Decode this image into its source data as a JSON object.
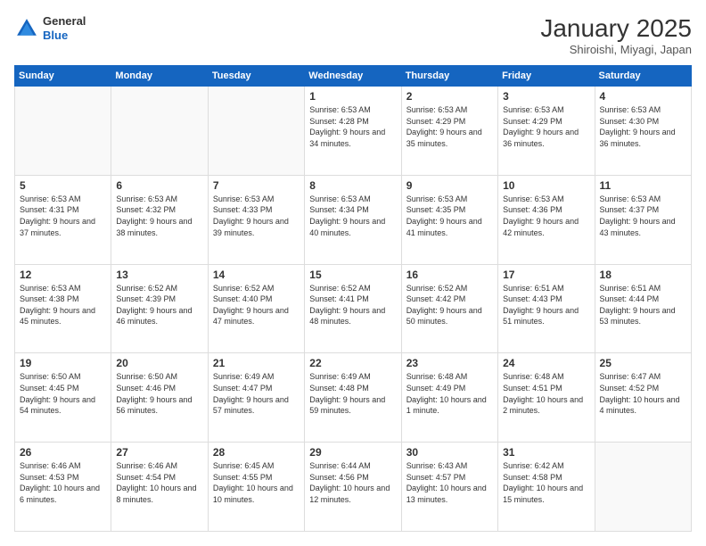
{
  "header": {
    "logo_line1": "General",
    "logo_line2": "Blue",
    "month_title": "January 2025",
    "subtitle": "Shiroishi, Miyagi, Japan"
  },
  "days_of_week": [
    "Sunday",
    "Monday",
    "Tuesday",
    "Wednesday",
    "Thursday",
    "Friday",
    "Saturday"
  ],
  "weeks": [
    [
      {
        "num": "",
        "empty": true
      },
      {
        "num": "",
        "empty": true
      },
      {
        "num": "",
        "empty": true
      },
      {
        "num": "1",
        "sunrise": "6:53 AM",
        "sunset": "4:28 PM",
        "daylight": "9 hours and 34 minutes."
      },
      {
        "num": "2",
        "sunrise": "6:53 AM",
        "sunset": "4:29 PM",
        "daylight": "9 hours and 35 minutes."
      },
      {
        "num": "3",
        "sunrise": "6:53 AM",
        "sunset": "4:29 PM",
        "daylight": "9 hours and 36 minutes."
      },
      {
        "num": "4",
        "sunrise": "6:53 AM",
        "sunset": "4:30 PM",
        "daylight": "9 hours and 36 minutes."
      }
    ],
    [
      {
        "num": "5",
        "sunrise": "6:53 AM",
        "sunset": "4:31 PM",
        "daylight": "9 hours and 37 minutes."
      },
      {
        "num": "6",
        "sunrise": "6:53 AM",
        "sunset": "4:32 PM",
        "daylight": "9 hours and 38 minutes."
      },
      {
        "num": "7",
        "sunrise": "6:53 AM",
        "sunset": "4:33 PM",
        "daylight": "9 hours and 39 minutes."
      },
      {
        "num": "8",
        "sunrise": "6:53 AM",
        "sunset": "4:34 PM",
        "daylight": "9 hours and 40 minutes."
      },
      {
        "num": "9",
        "sunrise": "6:53 AM",
        "sunset": "4:35 PM",
        "daylight": "9 hours and 41 minutes."
      },
      {
        "num": "10",
        "sunrise": "6:53 AM",
        "sunset": "4:36 PM",
        "daylight": "9 hours and 42 minutes."
      },
      {
        "num": "11",
        "sunrise": "6:53 AM",
        "sunset": "4:37 PM",
        "daylight": "9 hours and 43 minutes."
      }
    ],
    [
      {
        "num": "12",
        "sunrise": "6:53 AM",
        "sunset": "4:38 PM",
        "daylight": "9 hours and 45 minutes."
      },
      {
        "num": "13",
        "sunrise": "6:52 AM",
        "sunset": "4:39 PM",
        "daylight": "9 hours and 46 minutes."
      },
      {
        "num": "14",
        "sunrise": "6:52 AM",
        "sunset": "4:40 PM",
        "daylight": "9 hours and 47 minutes."
      },
      {
        "num": "15",
        "sunrise": "6:52 AM",
        "sunset": "4:41 PM",
        "daylight": "9 hours and 48 minutes."
      },
      {
        "num": "16",
        "sunrise": "6:52 AM",
        "sunset": "4:42 PM",
        "daylight": "9 hours and 50 minutes."
      },
      {
        "num": "17",
        "sunrise": "6:51 AM",
        "sunset": "4:43 PM",
        "daylight": "9 hours and 51 minutes."
      },
      {
        "num": "18",
        "sunrise": "6:51 AM",
        "sunset": "4:44 PM",
        "daylight": "9 hours and 53 minutes."
      }
    ],
    [
      {
        "num": "19",
        "sunrise": "6:50 AM",
        "sunset": "4:45 PM",
        "daylight": "9 hours and 54 minutes."
      },
      {
        "num": "20",
        "sunrise": "6:50 AM",
        "sunset": "4:46 PM",
        "daylight": "9 hours and 56 minutes."
      },
      {
        "num": "21",
        "sunrise": "6:49 AM",
        "sunset": "4:47 PM",
        "daylight": "9 hours and 57 minutes."
      },
      {
        "num": "22",
        "sunrise": "6:49 AM",
        "sunset": "4:48 PM",
        "daylight": "9 hours and 59 minutes."
      },
      {
        "num": "23",
        "sunrise": "6:48 AM",
        "sunset": "4:49 PM",
        "daylight": "10 hours and 1 minute."
      },
      {
        "num": "24",
        "sunrise": "6:48 AM",
        "sunset": "4:51 PM",
        "daylight": "10 hours and 2 minutes."
      },
      {
        "num": "25",
        "sunrise": "6:47 AM",
        "sunset": "4:52 PM",
        "daylight": "10 hours and 4 minutes."
      }
    ],
    [
      {
        "num": "26",
        "sunrise": "6:46 AM",
        "sunset": "4:53 PM",
        "daylight": "10 hours and 6 minutes."
      },
      {
        "num": "27",
        "sunrise": "6:46 AM",
        "sunset": "4:54 PM",
        "daylight": "10 hours and 8 minutes."
      },
      {
        "num": "28",
        "sunrise": "6:45 AM",
        "sunset": "4:55 PM",
        "daylight": "10 hours and 10 minutes."
      },
      {
        "num": "29",
        "sunrise": "6:44 AM",
        "sunset": "4:56 PM",
        "daylight": "10 hours and 12 minutes."
      },
      {
        "num": "30",
        "sunrise": "6:43 AM",
        "sunset": "4:57 PM",
        "daylight": "10 hours and 13 minutes."
      },
      {
        "num": "31",
        "sunrise": "6:42 AM",
        "sunset": "4:58 PM",
        "daylight": "10 hours and 15 minutes."
      },
      {
        "num": "",
        "empty": true
      }
    ]
  ]
}
